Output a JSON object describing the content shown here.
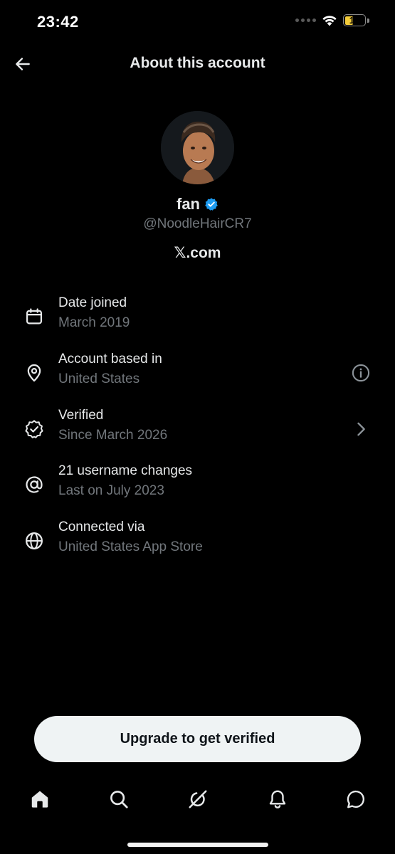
{
  "status_bar": {
    "time": "23:42",
    "battery_level": "13",
    "battery_fraction": 0.13,
    "icons": [
      "signal-dots-icon",
      "wifi-icon",
      "battery-icon"
    ]
  },
  "header": {
    "title": "About this account",
    "back_icon": "arrow-left-icon"
  },
  "profile": {
    "name": "fan",
    "handle": "@NoodleHairCR7",
    "site": "𝕏.com",
    "verified_badge_color": "#1d9bf0"
  },
  "rows": [
    {
      "icon": "calendar-icon",
      "title": "Date joined",
      "subtitle": "March 2019"
    },
    {
      "icon": "location-pin-icon",
      "title": "Account based in",
      "subtitle": "United States",
      "action_icon": "info-icon"
    },
    {
      "icon": "verified-badge-icon",
      "title": "Verified",
      "subtitle": "Since March 2026",
      "action_icon": "chevron-right-icon"
    },
    {
      "icon": "at-sign-icon",
      "title": "21 username changes",
      "subtitle": "Last on July 2023"
    },
    {
      "icon": "globe-icon",
      "title": "Connected via",
      "subtitle": "United States App Store"
    }
  ],
  "upgrade_button": {
    "label": "Upgrade to get verified"
  },
  "bottom_nav": {
    "items": [
      "home-icon",
      "search-icon",
      "grok-icon",
      "notifications-bell-icon",
      "messages-icon"
    ]
  },
  "colors": {
    "background": "#000000",
    "primary_text": "#e7e9ea",
    "secondary_text": "#71767b",
    "accent_blue": "#1d9bf0",
    "battery_low": "#f4cc3a",
    "button_bg": "#eff3f4"
  }
}
